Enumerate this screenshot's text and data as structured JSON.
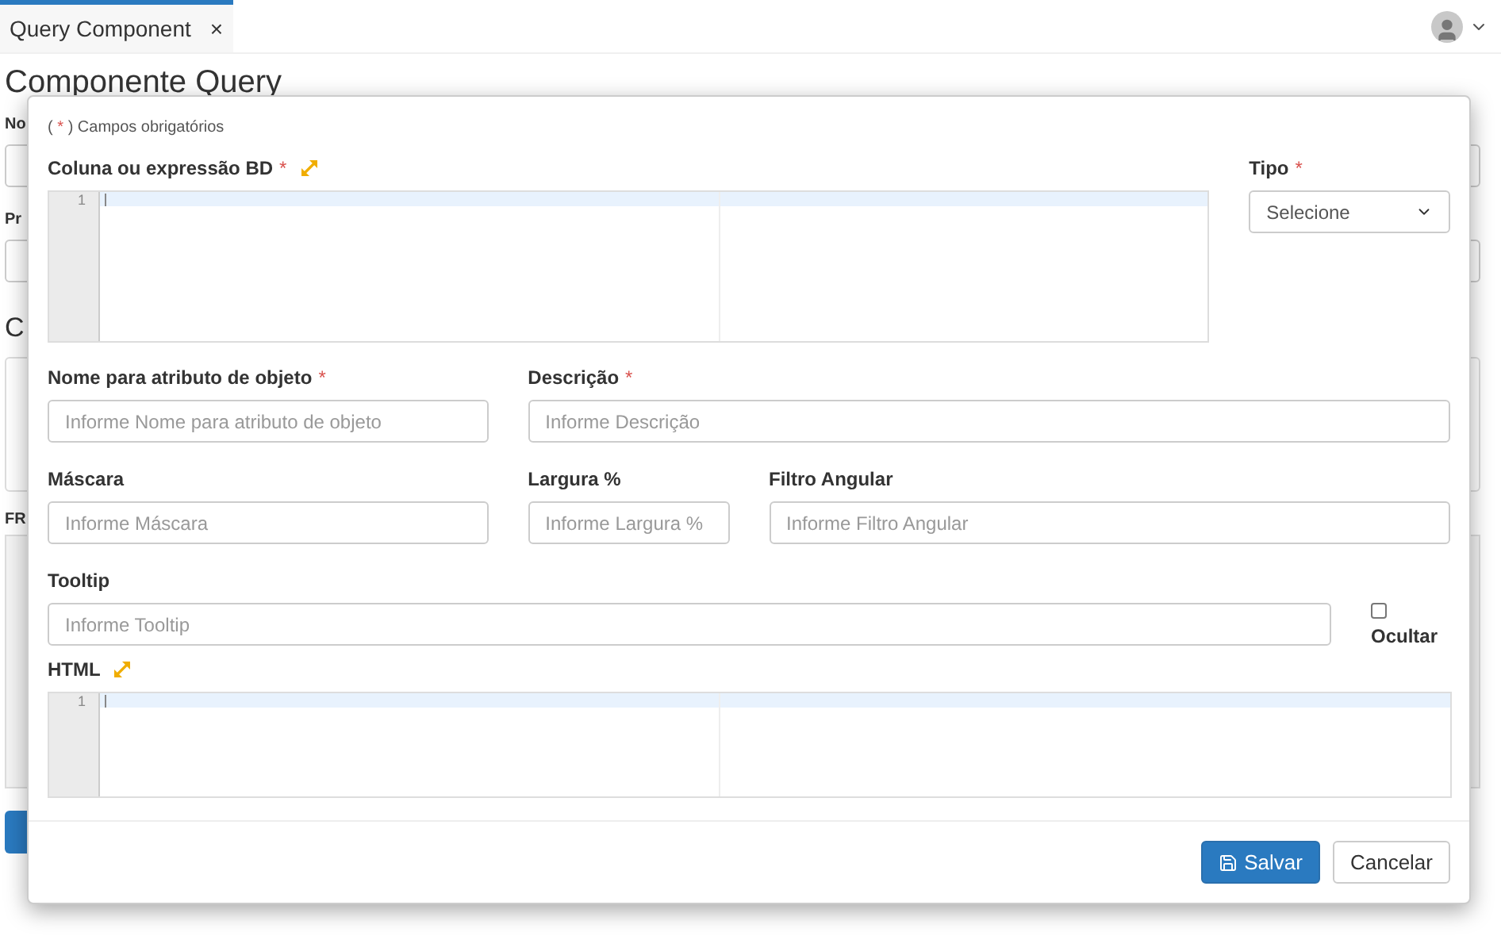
{
  "tabs": [
    {
      "label": "Query Component",
      "selected": true,
      "close": "×"
    }
  ],
  "page": {
    "title": "Componente Query",
    "background_labels": [
      "No",
      "Pr",
      "C",
      "FR"
    ]
  },
  "modal": {
    "note": {
      "prefix": "(",
      "mark": "*",
      "suffix": ") Campos obrigatórios"
    },
    "required_mark": "*",
    "coluna": {
      "label": "Coluna ou expressão BD",
      "required": true,
      "line_number": "1"
    },
    "tipo": {
      "label": "Tipo",
      "required": true,
      "value": "Selecione"
    },
    "nome": {
      "label": "Nome para atributo de objeto",
      "required": true,
      "placeholder": "Informe Nome para atributo de objeto"
    },
    "descricao": {
      "label": "Descrição",
      "required": true,
      "placeholder": "Informe Descrição"
    },
    "mascara": {
      "label": "Máscara",
      "required": false,
      "placeholder": "Informe Máscara"
    },
    "largura": {
      "label": "Largura %",
      "required": false,
      "placeholder": "Informe Largura %"
    },
    "filtro": {
      "label": "Filtro Angular",
      "required": false,
      "placeholder": "Informe Filtro Angular"
    },
    "tooltip": {
      "label": "Tooltip",
      "required": false,
      "placeholder": "Informe Tooltip"
    },
    "ocultar": {
      "label": "Ocultar",
      "checked": false
    },
    "html": {
      "label": "HTML",
      "required": false,
      "line_number": "1"
    },
    "buttons": [
      {
        "kind": "primary",
        "label": "Salvar"
      },
      {
        "kind": "secondary",
        "label": "Cancelar"
      }
    ]
  }
}
